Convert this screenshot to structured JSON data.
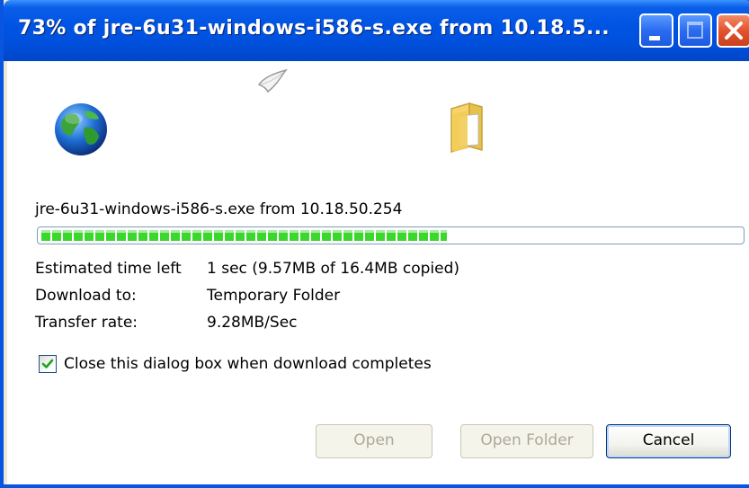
{
  "window": {
    "title": "73% of jre-6u31-windows-i586-s.exe from 10.18.5...",
    "accent_color": "#0054e3"
  },
  "icons": {
    "globe": "globe-icon",
    "paper": "flying-paper-icon",
    "folder": "folder-icon",
    "minimize": "minimize-icon",
    "maximize": "maximize-icon",
    "close": "close-icon",
    "check": "checkmark-icon"
  },
  "download": {
    "source": "jre-6u31-windows-i586-s.exe from 10.18.50.254",
    "progress_percent": 58,
    "progress_color": "#3bd72e",
    "estimated_label": "Estimated time left",
    "estimated_value": "1 sec (9.57MB of 16.4MB copied)",
    "download_to_label": "Download to:",
    "download_to_value": "Temporary Folder",
    "transfer_rate_label": "Transfer rate:",
    "transfer_rate_value": "9.28MB/Sec"
  },
  "options": {
    "close_when_done_label": "Close this dialog box when download completes",
    "close_when_done_checked": true
  },
  "buttons": {
    "open": "Open",
    "open_folder": "Open Folder",
    "cancel": "Cancel"
  }
}
